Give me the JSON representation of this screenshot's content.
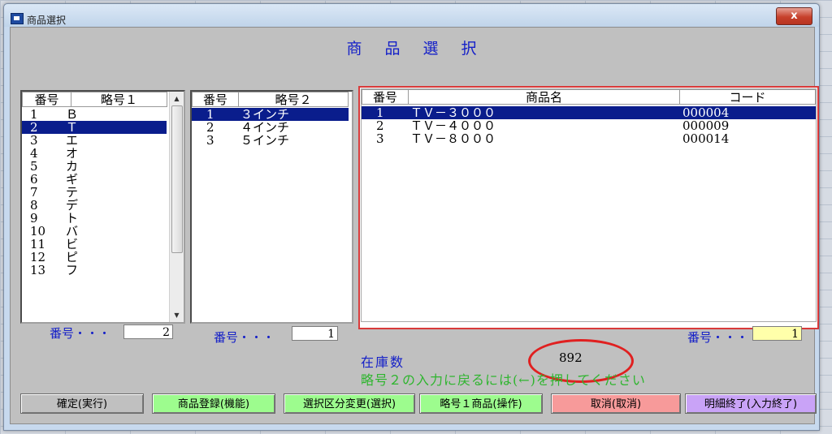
{
  "window": {
    "title": "商品選択",
    "close_label": "x"
  },
  "heading": [
    "商",
    "品",
    "選",
    "択"
  ],
  "list1": {
    "headers": [
      "番号",
      "略号１"
    ],
    "rows": [
      [
        "1",
        "Ｂ"
      ],
      [
        "2",
        "Ｔ"
      ],
      [
        "3",
        "エ"
      ],
      [
        "4",
        "オ"
      ],
      [
        "5",
        "カ"
      ],
      [
        "6",
        "ギ"
      ],
      [
        "7",
        "テ"
      ],
      [
        "8",
        "デ"
      ],
      [
        "9",
        "ト"
      ],
      [
        "10",
        "バ"
      ],
      [
        "11",
        "ビ"
      ],
      [
        "12",
        "ピ"
      ],
      [
        "13",
        "フ"
      ]
    ],
    "selected_index": 1,
    "number_label": "番号・・・",
    "number_value": "2"
  },
  "list2": {
    "headers": [
      "番号",
      "略号２"
    ],
    "rows": [
      [
        "1",
        "３インチ"
      ],
      [
        "2",
        "４インチ"
      ],
      [
        "3",
        "５インチ"
      ]
    ],
    "selected_index": 0,
    "number_label": "番号・・・",
    "number_value": "1"
  },
  "list3": {
    "headers": [
      "番号",
      "商品名",
      "コード"
    ],
    "rows": [
      [
        "1",
        "ＴＶ－３０００",
        "000004"
      ],
      [
        "2",
        "ＴＶ－４０００",
        "000009"
      ],
      [
        "3",
        "ＴＶ－８０００",
        "000014"
      ]
    ],
    "selected_index": 0,
    "number_label": "番号・・・",
    "number_value": "1"
  },
  "stock": {
    "label": "在庫数",
    "value": "892"
  },
  "hint": "略号２の入力に戻るには(←)を押してください",
  "buttons": [
    {
      "label": "確定(実行)",
      "color": "#c0c0c0"
    },
    {
      "label": "商品登録(機能)",
      "color": "#9dfc8e"
    },
    {
      "label": "選択区分変更(選択)",
      "color": "#9dfc8e"
    },
    {
      "label": "略号１商品(操作)",
      "color": "#9dfc8e"
    },
    {
      "label": "取消(取消)",
      "color": "#f79a9a"
    },
    {
      "label": "明細終了(入力終了)",
      "color": "#c9a3f7"
    }
  ],
  "colors": {
    "selection": "#0a1d8c",
    "heading": "#1520c8",
    "hint": "#2fb52f",
    "accent_red": "#d83a3a"
  }
}
